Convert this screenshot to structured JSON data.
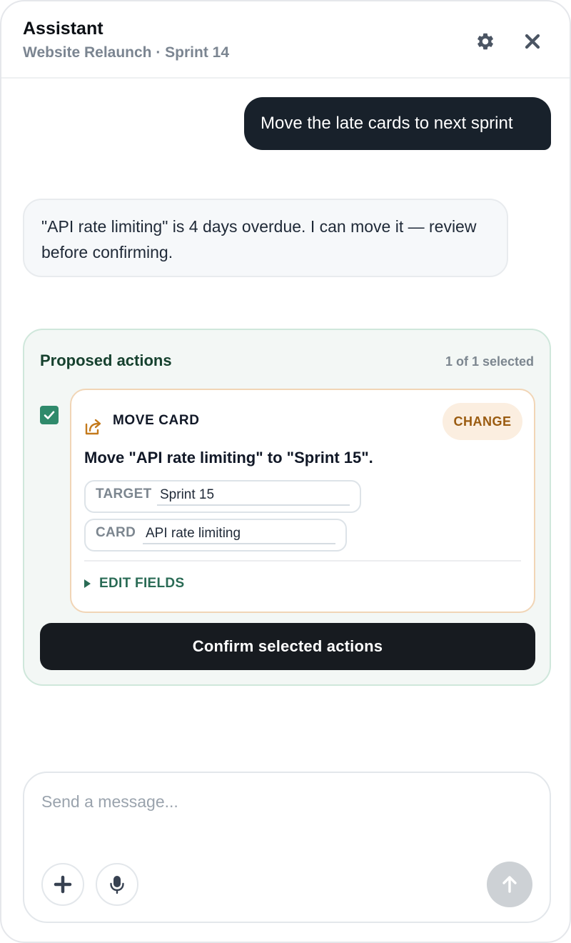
{
  "header": {
    "title": "Assistant",
    "subtitle": "Website Relaunch · Sprint 14",
    "icons": [
      "gear-icon",
      "close-icon"
    ]
  },
  "messages": {
    "user": "Move the late cards to next sprint",
    "assistant": "\"API rate limiting\" is 4 days overdue. I can move it — review before confirming."
  },
  "actions": {
    "title": "Proposed actions",
    "count": "1 of 1 selected",
    "items": [
      {
        "checked": true,
        "icon": "move-card-icon",
        "type": "MOVE CARD",
        "change_label": "CHANGE",
        "description": "Move \"API rate limiting\" to \"Sprint 15\".",
        "fields": [
          {
            "label": "TARGET",
            "value": "Sprint 15"
          },
          {
            "label": "CARD",
            "value": "API rate limiting"
          }
        ],
        "edit_label": "EDIT FIELDS"
      }
    ],
    "confirm_label": "Confirm selected actions"
  },
  "composer": {
    "placeholder": "Send a message...",
    "icons": [
      "plus-icon",
      "microphone-icon",
      "arrow-up-icon"
    ]
  },
  "colors": {
    "user_bubble": "#18212b",
    "accent_green": "#2f8a6b",
    "action_title": "#16412e",
    "change_text": "#9a5b10",
    "change_bg": "#fbeee0",
    "card_border": "#f1d5b6",
    "confirm_bg": "#171b20",
    "send_disabled": "#cdd1d5"
  }
}
